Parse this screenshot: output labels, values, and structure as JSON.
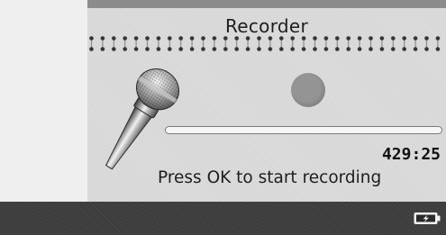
{
  "app": {
    "title": "Recorder"
  },
  "recorder": {
    "remaining_time": "429:25",
    "progress": 0,
    "hint": "Press OK to start recording"
  },
  "status_bar": {
    "battery_icon": "battery-charging-icon"
  },
  "icons": {
    "microphone": "microphone-icon",
    "record": "record-icon"
  },
  "colors": {
    "screen_bg": "#dcdcdc",
    "status_bar_bg": "#3c3c3c",
    "record_dot": "#949494"
  }
}
